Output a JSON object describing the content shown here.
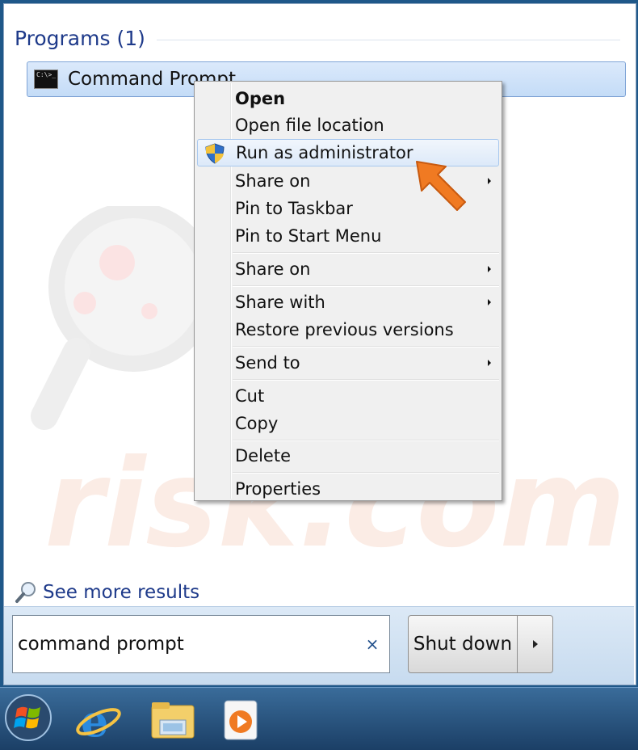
{
  "programs": {
    "title": "Programs (1)",
    "items": [
      {
        "label": "Command Prompt",
        "icon": "cmd-icon"
      }
    ]
  },
  "see_more": {
    "label": "See more results",
    "icon": "search-icon"
  },
  "search": {
    "value": "command prompt",
    "clear_icon": "×"
  },
  "shutdown": {
    "label": "Shut down",
    "arrow_icon": "chevron-right-icon"
  },
  "watermark": {
    "text": "PC risk.com"
  },
  "context_menu": {
    "items": [
      {
        "label": "Open",
        "bold": true
      },
      {
        "label": "Open file location"
      },
      {
        "label": "Run as administrator",
        "icon": "uac-shield-icon",
        "highlighted": true
      },
      {
        "label": "Share on",
        "submenu": true
      },
      {
        "label": "Pin to Taskbar"
      },
      {
        "label": "Pin to Start Menu"
      },
      {
        "label": "Share on",
        "submenu": true
      },
      {
        "label": "Share with",
        "submenu": true
      },
      {
        "label": "Restore previous versions"
      },
      {
        "label": "Send to",
        "submenu": true
      },
      {
        "label": "Cut"
      },
      {
        "label": "Copy"
      },
      {
        "label": "Delete"
      },
      {
        "label": "Properties"
      }
    ]
  },
  "taskbar": {
    "items": [
      {
        "name": "start-orb-icon"
      },
      {
        "name": "internet-explorer-icon"
      },
      {
        "name": "windows-explorer-icon"
      },
      {
        "name": "media-player-icon"
      }
    ]
  },
  "colors": {
    "accent_text": "#1e3a8a",
    "highlight": "#c4dcf7",
    "pointer_arrow": "#f07a22"
  }
}
